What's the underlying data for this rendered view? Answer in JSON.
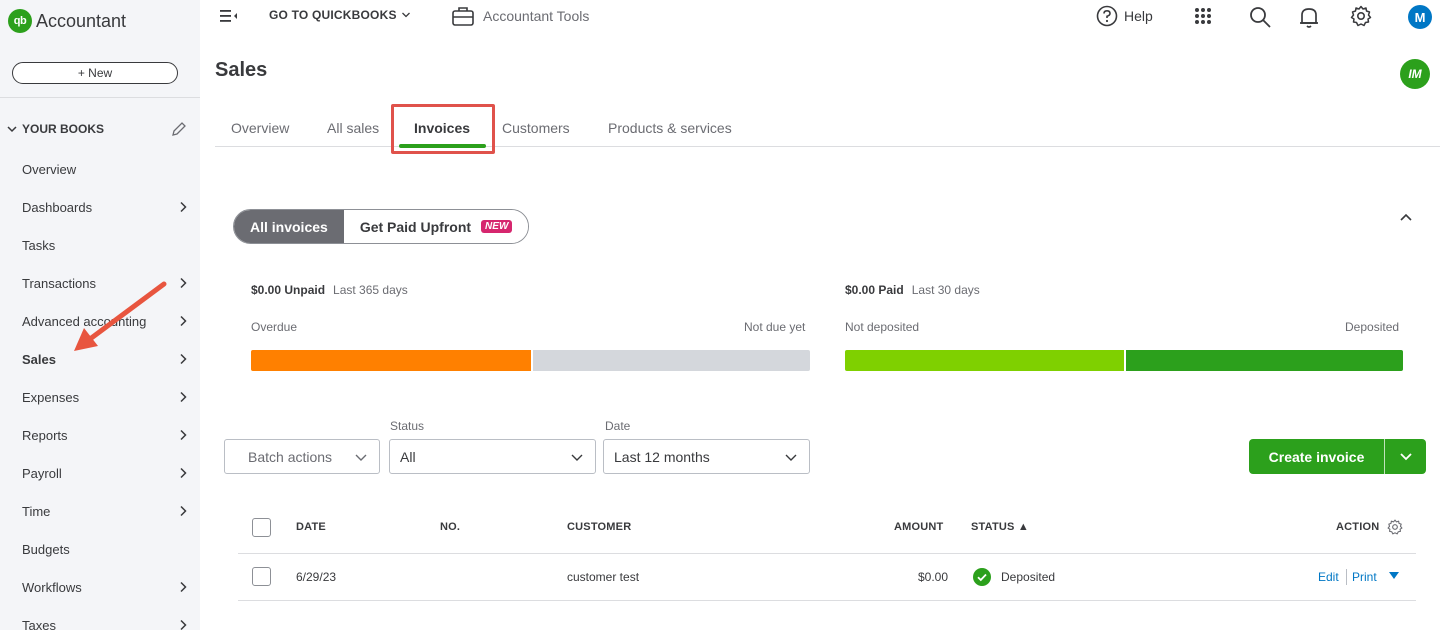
{
  "sidebar": {
    "logo_badge": "qb",
    "logo_text": "Accountant",
    "new_button": "+ New",
    "section_title": "YOUR BOOKS",
    "items": [
      {
        "label": "Overview",
        "chevron": false
      },
      {
        "label": "Dashboards",
        "chevron": true
      },
      {
        "label": "Tasks",
        "chevron": false
      },
      {
        "label": "Transactions",
        "chevron": true
      },
      {
        "label": "Advanced accounting",
        "chevron": true
      },
      {
        "label": "Sales",
        "chevron": true,
        "active": true
      },
      {
        "label": "Expenses",
        "chevron": true
      },
      {
        "label": "Reports",
        "chevron": true
      },
      {
        "label": "Payroll",
        "chevron": true
      },
      {
        "label": "Time",
        "chevron": true
      },
      {
        "label": "Budgets",
        "chevron": false
      },
      {
        "label": "Workflows",
        "chevron": true
      },
      {
        "label": "Taxes",
        "chevron": true
      }
    ]
  },
  "topbar": {
    "goto_label": "GO TO QUICKBOOKS",
    "accountant_tools": "Accountant Tools",
    "help_label": "Help",
    "user_initial": "M",
    "secondary_avatar": "IM"
  },
  "page": {
    "title": "Sales",
    "tabs": [
      "Overview",
      "All sales",
      "Invoices",
      "Customers",
      "Products & services"
    ],
    "active_tab": "Invoices"
  },
  "segment": {
    "all_invoices": "All invoices",
    "get_paid": "Get Paid Upfront",
    "new_badge": "NEW"
  },
  "unpaid": {
    "amount": "$0.00 Unpaid",
    "period": "Last 365 days",
    "left_label": "Overdue",
    "right_label": "Not due yet",
    "overdue_fraction": 0.5
  },
  "paid": {
    "amount": "$0.00 Paid",
    "period": "Last 30 days",
    "left_label": "Not deposited",
    "right_label": "Deposited",
    "not_deposited_fraction": 0.5
  },
  "colors": {
    "overdue": "#ff8000",
    "not_due": "#d4d7dc",
    "not_deposited": "#7fd000",
    "deposited": "#2ca01c",
    "brand_green": "#2ca01c",
    "link_blue": "#0077c5",
    "highlight_red": "#e0524b"
  },
  "filters": {
    "batch_actions": "Batch actions",
    "status_label": "Status",
    "status_value": "All",
    "date_label": "Date",
    "date_value": "Last 12 months"
  },
  "create_invoice": "Create invoice",
  "table": {
    "headers": {
      "date": "DATE",
      "no": "NO.",
      "customer": "CUSTOMER",
      "amount": "AMOUNT",
      "status": "STATUS ▲",
      "action": "ACTION"
    },
    "rows": [
      {
        "date": "6/29/23",
        "no": "",
        "customer": "customer test",
        "amount": "$0.00",
        "status": "Deposited",
        "edit": "Edit",
        "print": "Print"
      }
    ]
  }
}
